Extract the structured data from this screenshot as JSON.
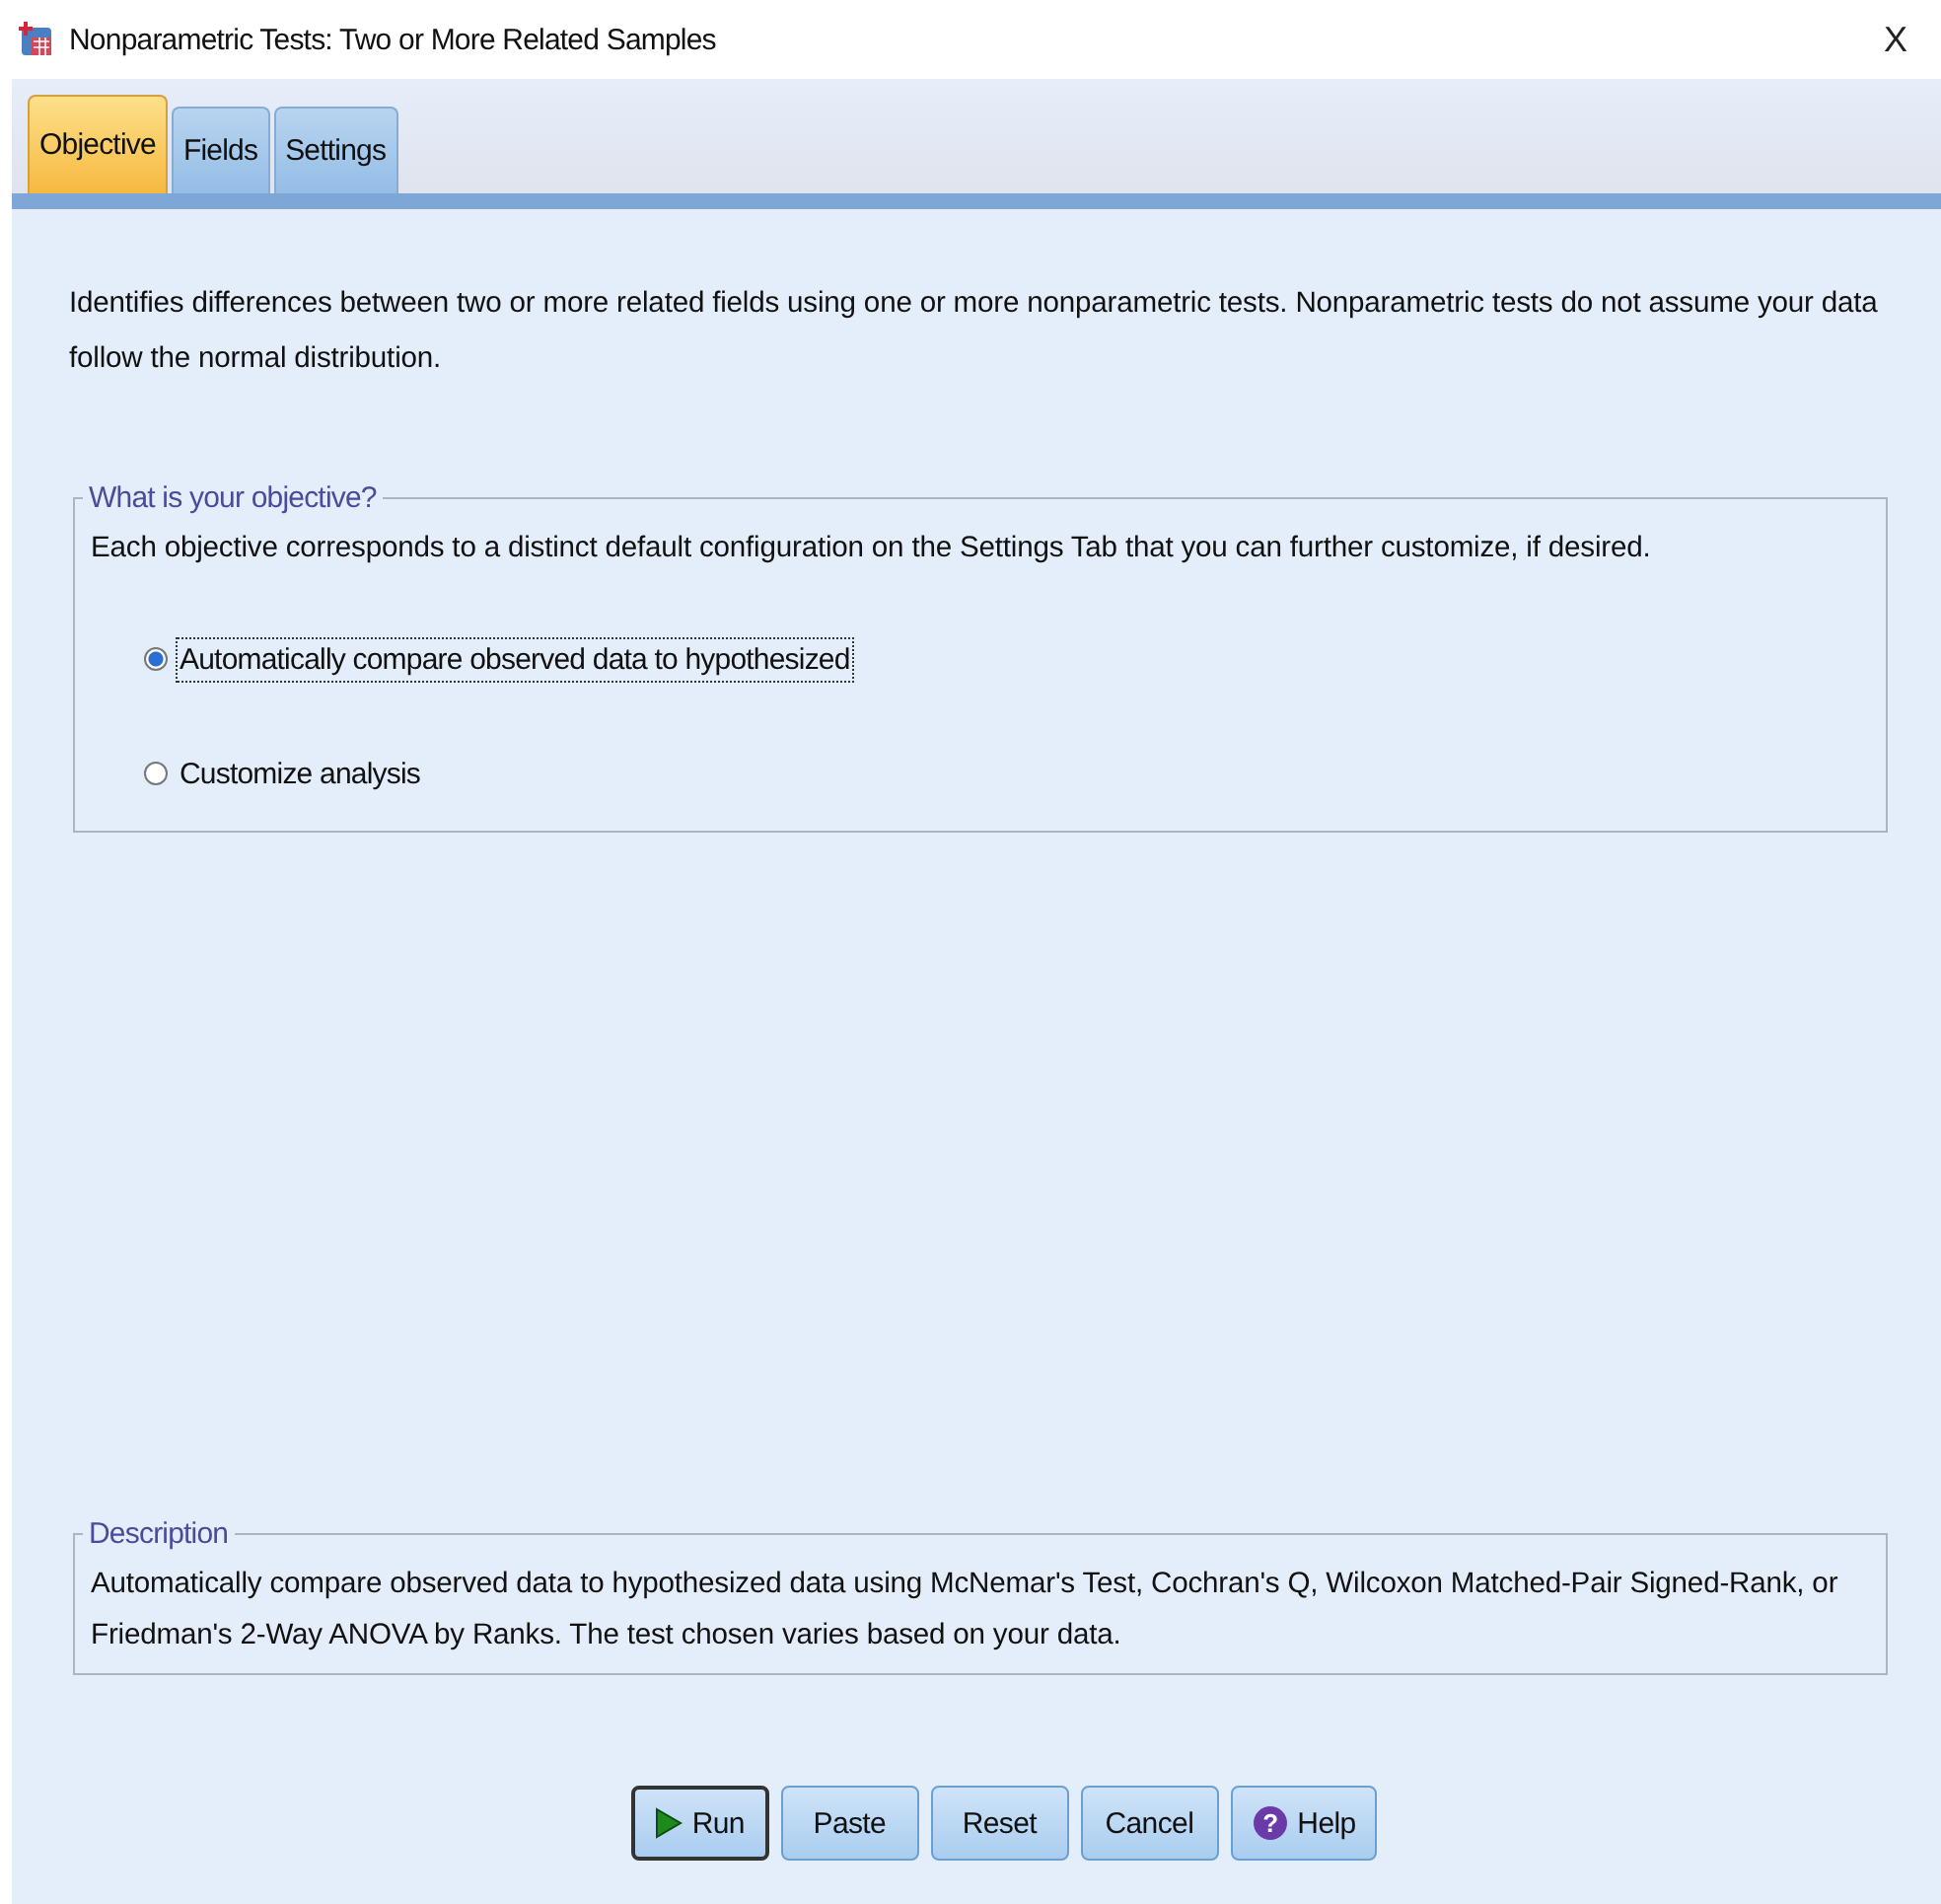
{
  "window": {
    "title": "Nonparametric Tests: Two or More Related Samples",
    "close": "X"
  },
  "tabs": [
    {
      "label": "Objective",
      "selected": true
    },
    {
      "label": "Fields",
      "selected": false
    },
    {
      "label": "Settings",
      "selected": false
    }
  ],
  "intro": "Identifies differences between two or more related fields using one or more nonparametric tests. Nonparametric tests do not assume your data follow the normal distribution.",
  "objective_group": {
    "legend": "What is your objective?",
    "text": "Each objective corresponds to a distinct default configuration on the Settings Tab that you can further customize, if desired.",
    "options": [
      {
        "label": "Automatically compare observed data to hypothesized",
        "selected": true,
        "focused": true
      },
      {
        "label": "Customize analysis",
        "selected": false,
        "focused": false
      }
    ]
  },
  "description_group": {
    "legend": "Description",
    "text": "Automatically compare observed data to hypothesized data using McNemar's Test, Cochran's Q, Wilcoxon Matched-Pair Signed-Rank, or Friedman's 2-Way ANOVA by Ranks.  The test chosen varies based on your data."
  },
  "buttons": [
    {
      "label": "Run",
      "kind": "run",
      "default": true
    },
    {
      "label": "Paste",
      "kind": "plain",
      "default": false
    },
    {
      "label": "Reset",
      "kind": "plain",
      "default": false
    },
    {
      "label": "Cancel",
      "kind": "plain",
      "default": false
    },
    {
      "label": "Help",
      "kind": "help",
      "default": false,
      "icon": "?"
    }
  ]
}
